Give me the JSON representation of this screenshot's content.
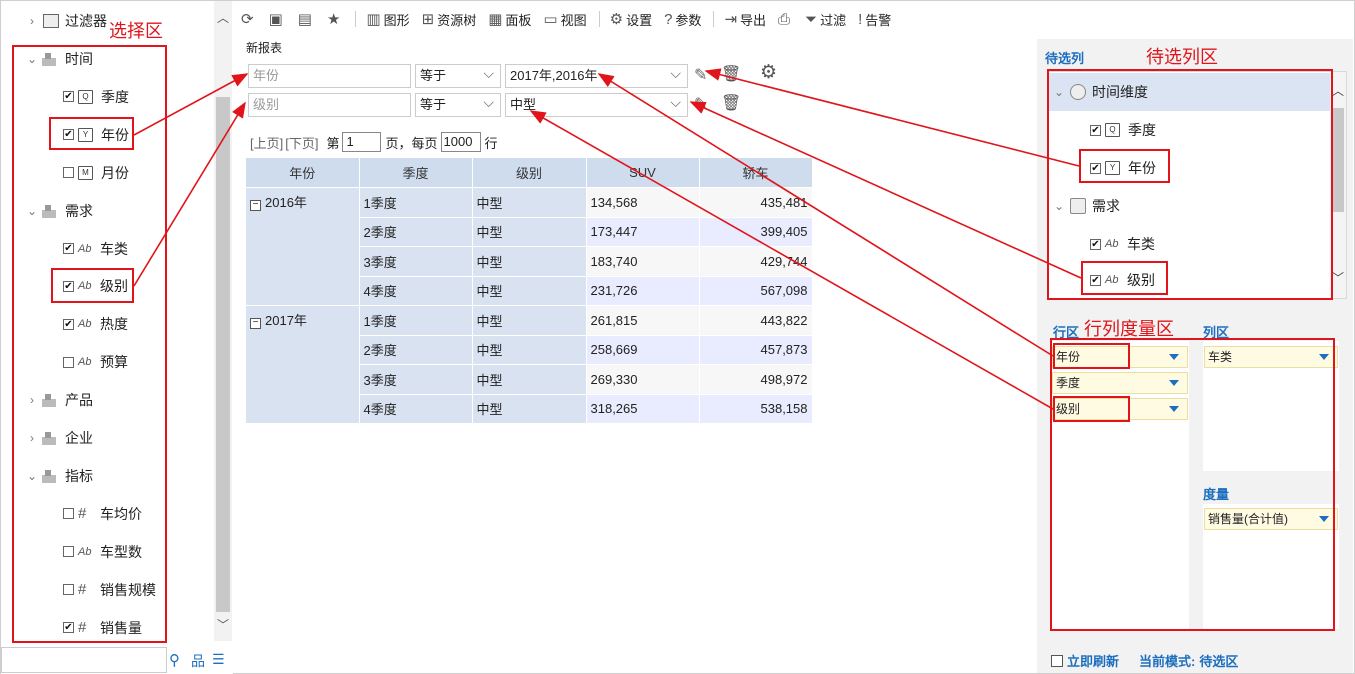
{
  "left": {
    "filter_label": "过滤器",
    "items": [
      {
        "type": "dim",
        "label": "时间",
        "expanded": true
      },
      {
        "type": "date",
        "label": "季度",
        "checked": true,
        "glyph": "Q"
      },
      {
        "type": "date",
        "label": "年份",
        "checked": true,
        "glyph": "Y"
      },
      {
        "type": "date",
        "label": "月份",
        "checked": false,
        "glyph": "M"
      },
      {
        "type": "dim",
        "label": "需求",
        "expanded": true
      },
      {
        "type": "text",
        "label": "车类",
        "checked": true
      },
      {
        "type": "text",
        "label": "级别",
        "checked": true
      },
      {
        "type": "text",
        "label": "热度",
        "checked": true
      },
      {
        "type": "text",
        "label": "预算",
        "checked": false
      },
      {
        "type": "dim",
        "label": "产品",
        "expanded": false
      },
      {
        "type": "dim",
        "label": "企业",
        "expanded": false
      },
      {
        "type": "dim",
        "label": "指标",
        "expanded": true
      },
      {
        "type": "measure",
        "label": "车均价",
        "checked": false
      },
      {
        "type": "measure",
        "label": "车型数",
        "checked": false,
        "textglyph": true
      },
      {
        "type": "measure",
        "label": "销售规模",
        "checked": false
      },
      {
        "type": "measure",
        "label": "销售量",
        "checked": true
      }
    ]
  },
  "toolbar": {
    "items": [
      {
        "icon": "refresh-icon",
        "glyph": "⟳",
        "label": ""
      },
      {
        "icon": "save-icon",
        "glyph": "▣",
        "label": ""
      },
      {
        "icon": "save-as-icon",
        "glyph": "▤",
        "label": ""
      },
      {
        "icon": "star-icon",
        "glyph": "★",
        "label": ""
      },
      {
        "icon": "chart-icon",
        "glyph": "▥",
        "label": "图形"
      },
      {
        "icon": "resource-tree-icon",
        "glyph": "⊞",
        "label": "资源树"
      },
      {
        "icon": "panel-icon",
        "glyph": "▦",
        "label": "面板"
      },
      {
        "icon": "view-icon",
        "glyph": "▭",
        "label": "视图"
      },
      {
        "icon": "gear-icon",
        "glyph": "⚙",
        "label": "设置"
      },
      {
        "icon": "param-icon",
        "glyph": "?",
        "label": "参数"
      },
      {
        "icon": "export-icon",
        "glyph": "⇥",
        "label": "导出"
      },
      {
        "icon": "print-icon",
        "glyph": "⎙",
        "label": ""
      },
      {
        "icon": "filter-icon",
        "glyph": "⏷",
        "label": "过滤"
      },
      {
        "icon": "alert-icon",
        "glyph": "!",
        "label": "告警"
      }
    ]
  },
  "report_title": "新报表",
  "filters": [
    {
      "field_placeholder": "年份",
      "op": "等于",
      "value": "2017年,2016年"
    },
    {
      "field_placeholder": "级别",
      "op": "等于",
      "value": "中型"
    }
  ],
  "pager": {
    "prev": "[上页]",
    "next": "[下页]",
    "page_prefix": "第",
    "page": "1",
    "page_suffix": "页，每页",
    "size": "1000",
    "size_suffix": "行"
  },
  "table": {
    "headers": [
      "年份",
      "季度",
      "级别",
      "SUV",
      "轿车"
    ],
    "groups": [
      {
        "year": "2016年",
        "rows": [
          [
            "1季度",
            "中型",
            "134,568",
            "435,481"
          ],
          [
            "2季度",
            "中型",
            "173,447",
            "399,405"
          ],
          [
            "3季度",
            "中型",
            "183,740",
            "429,744"
          ],
          [
            "4季度",
            "中型",
            "231,726",
            "567,098"
          ]
        ]
      },
      {
        "year": "2017年",
        "rows": [
          [
            "1季度",
            "中型",
            "261,815",
            "443,822"
          ],
          [
            "2季度",
            "中型",
            "258,669",
            "457,873"
          ],
          [
            "3季度",
            "中型",
            "269,330",
            "498,972"
          ],
          [
            "4季度",
            "中型",
            "318,265",
            "538,158"
          ]
        ]
      }
    ]
  },
  "right": {
    "candidates_title": "待选列",
    "candidates": [
      {
        "type": "dim",
        "label": "时间维度",
        "highlight": true
      },
      {
        "type": "date",
        "label": "季度",
        "checked": true,
        "glyph": "Q"
      },
      {
        "type": "date",
        "label": "年份",
        "checked": true,
        "glyph": "Y"
      },
      {
        "type": "dim",
        "label": "需求"
      },
      {
        "type": "text",
        "label": "车类",
        "checked": true
      },
      {
        "type": "text",
        "label": "级别",
        "checked": true
      }
    ],
    "row_zone_title": "行区",
    "col_zone_title": "列区",
    "measure_zone_title": "度量",
    "row_chips": [
      "年份",
      "季度",
      "级别"
    ],
    "col_chips": [
      "车类"
    ],
    "measure_chips": [
      "销售量(合计值)"
    ],
    "refresh_label": "立即刷新",
    "mode_label": "当前模式:",
    "mode_value": "待选区"
  },
  "annotations": {
    "select_zone": "选择区",
    "candidate_zone": "待选列区",
    "rcm_zone": "行列度量区"
  }
}
